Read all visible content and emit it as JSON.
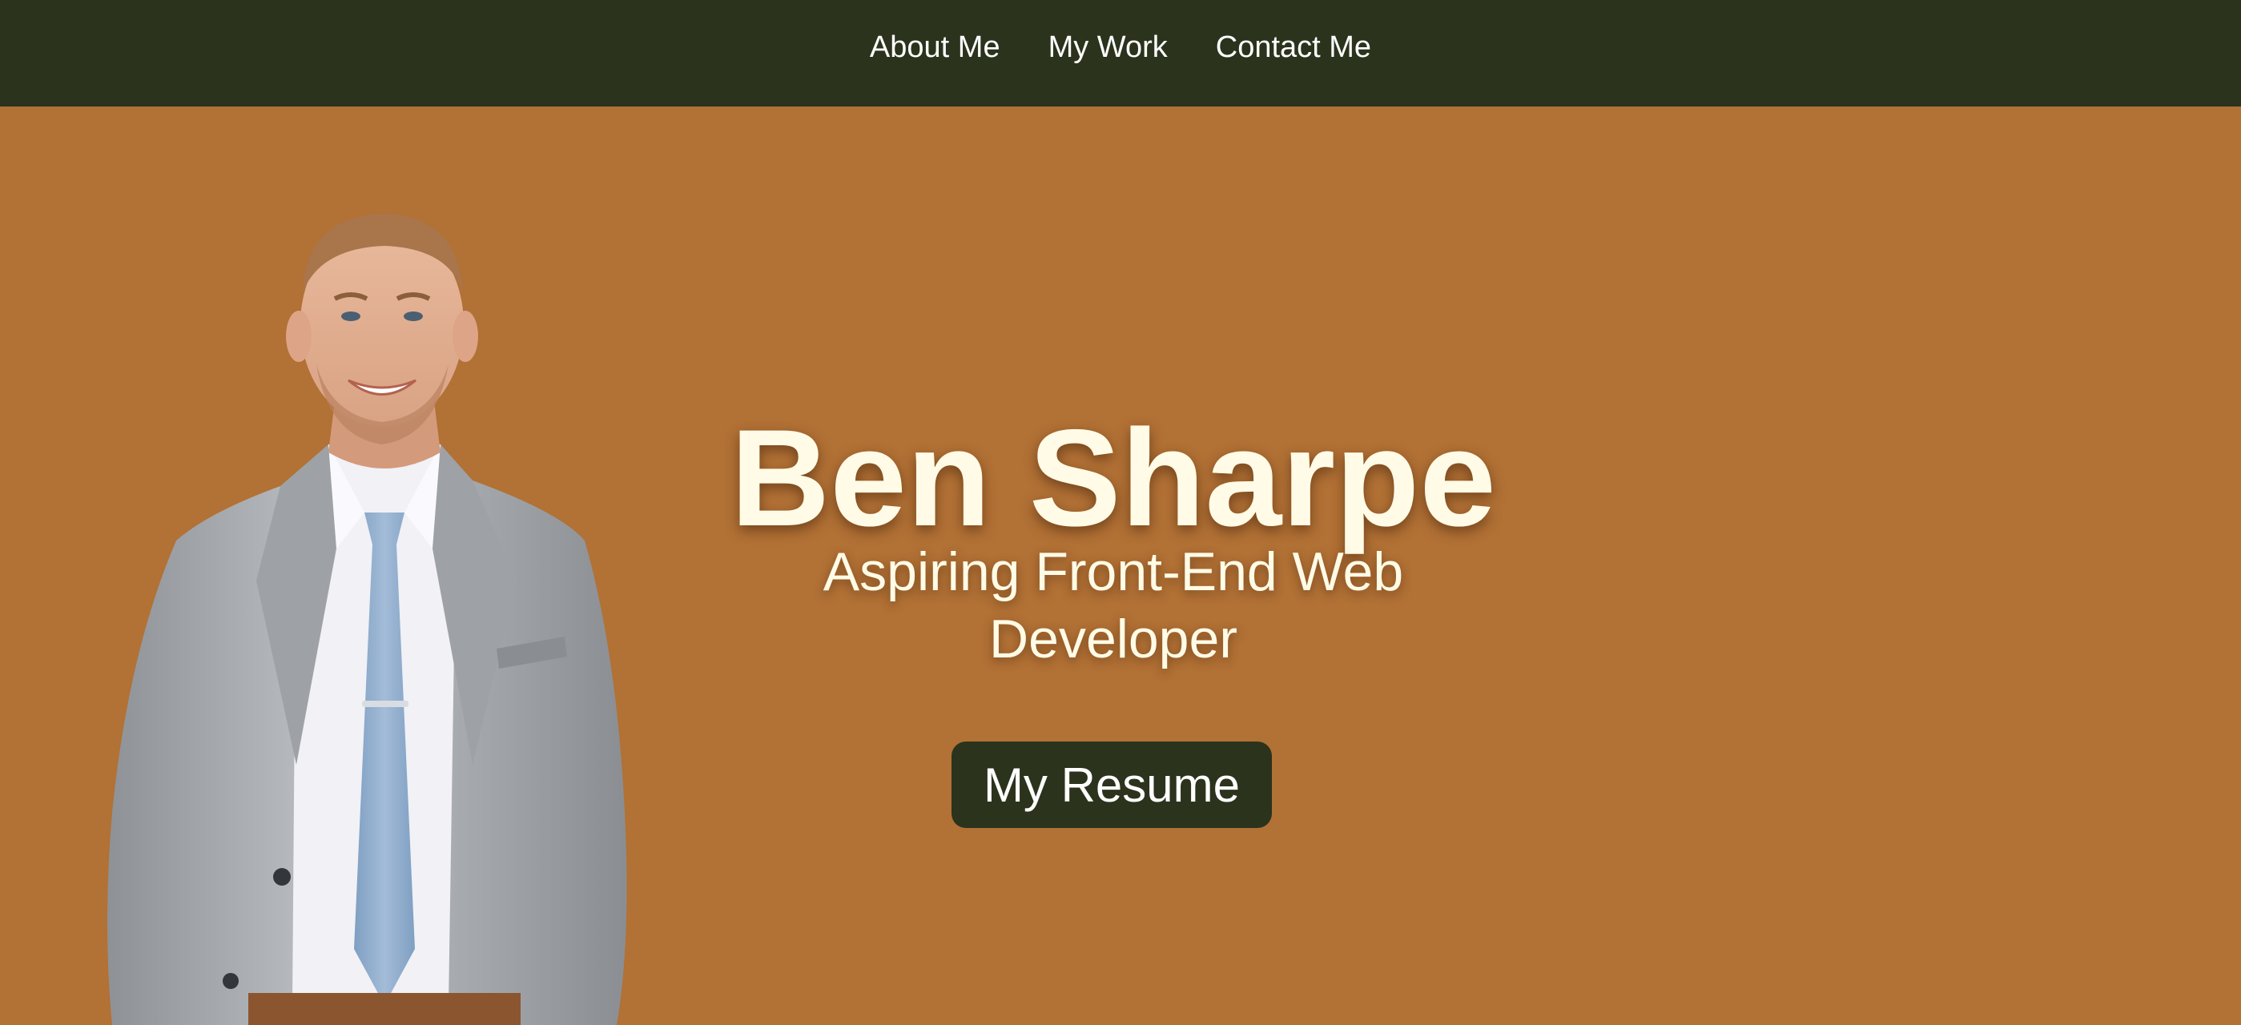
{
  "nav": {
    "links": [
      "About Me",
      "My Work",
      "Contact Me"
    ]
  },
  "hero": {
    "name": "Ben Sharpe",
    "subtitle_line1": "Aspiring Front-End Web",
    "subtitle_line2": "Developer",
    "button_label": "My Resume"
  },
  "colors": {
    "navbar": "#2B331D",
    "background": "#B27135",
    "headline_text": "#FFFBE6",
    "button": "#2B331D"
  }
}
